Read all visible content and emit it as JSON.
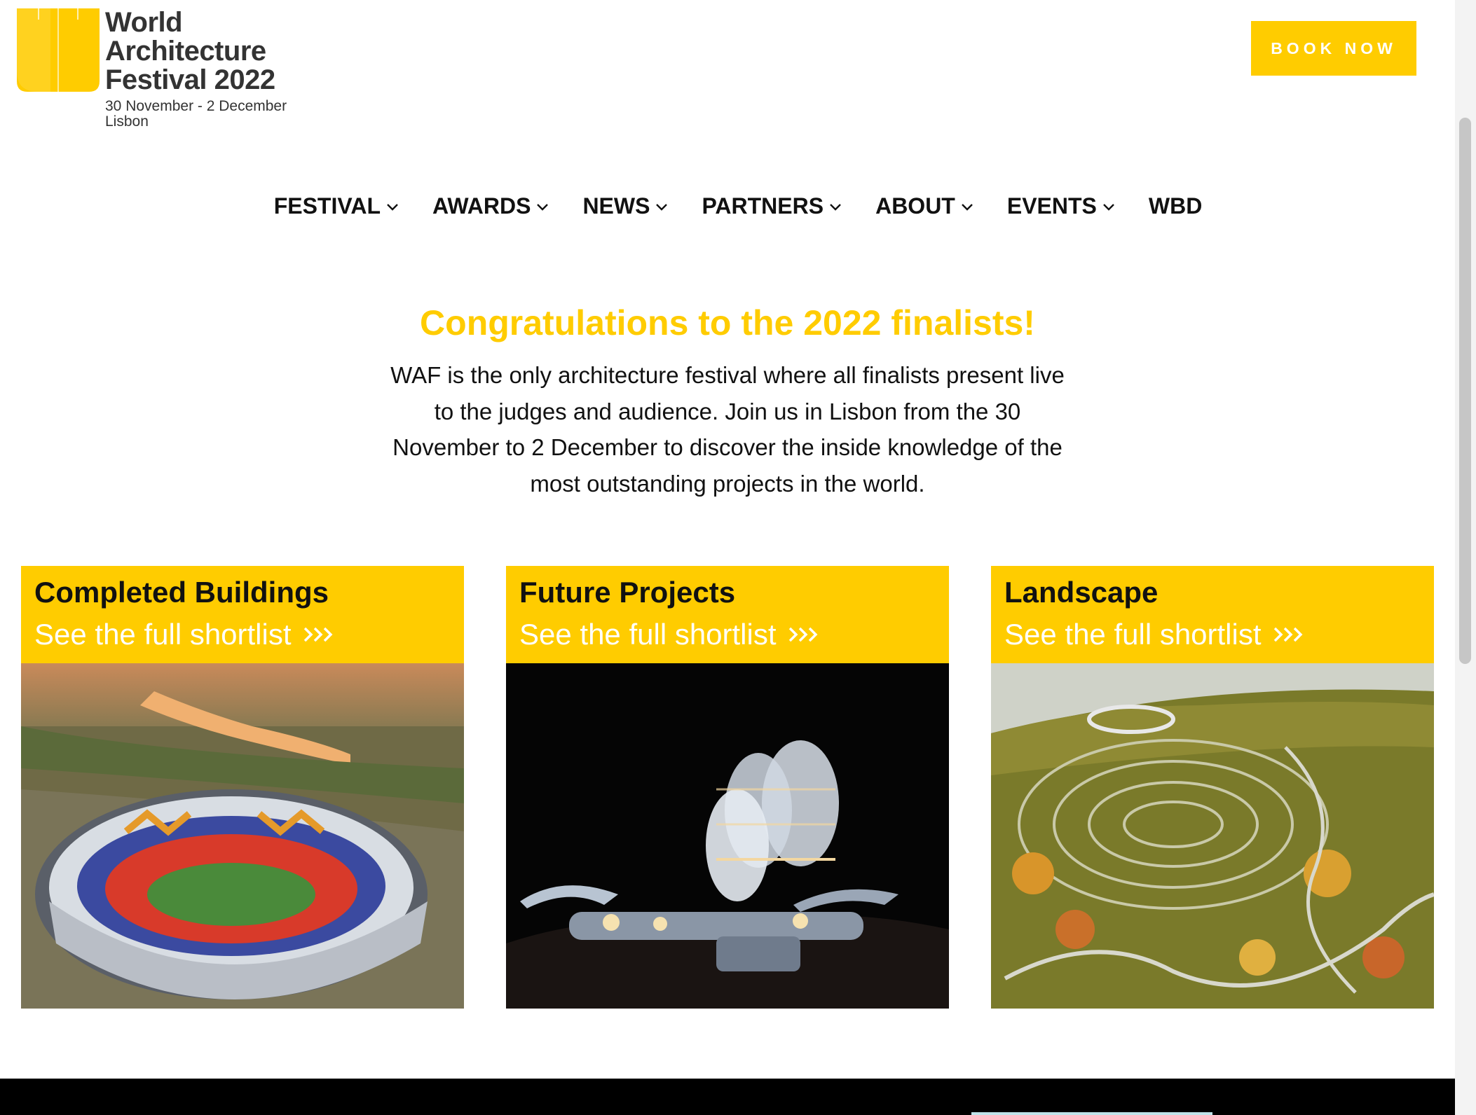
{
  "header": {
    "logo": {
      "line1": "World",
      "line2": "Architecture",
      "line3": "Festival 2022",
      "dates": "30 November - 2 December",
      "city": "Lisbon"
    },
    "book_button": "BOOK NOW"
  },
  "nav": {
    "items": [
      {
        "label": "FESTIVAL",
        "dropdown": true
      },
      {
        "label": "AWARDS",
        "dropdown": true
      },
      {
        "label": "NEWS",
        "dropdown": true
      },
      {
        "label": "PARTNERS",
        "dropdown": true
      },
      {
        "label": "ABOUT",
        "dropdown": true
      },
      {
        "label": "EVENTS",
        "dropdown": true
      },
      {
        "label": "WBD",
        "dropdown": false
      }
    ]
  },
  "hero": {
    "headline": "Congratulations to the 2022 finalists!",
    "body": "WAF is the only architecture festival where all finalists present live to the judges and audience. Join us in Lisbon from the 30 November to 2 December to discover the inside knowledge of the most outstanding projects in the world."
  },
  "cards": [
    {
      "title": "Completed Buildings",
      "link": "See the full shortlist",
      "image": "stadium-photo"
    },
    {
      "title": "Future Projects",
      "link": "See the full shortlist",
      "image": "futuristic-pods-render"
    },
    {
      "title": "Landscape",
      "link": "See the full shortlist",
      "image": "terraced-landscape-photo"
    }
  ],
  "colors": {
    "accent": "#FFCC00",
    "text": "#111111",
    "footer": "#000000"
  }
}
